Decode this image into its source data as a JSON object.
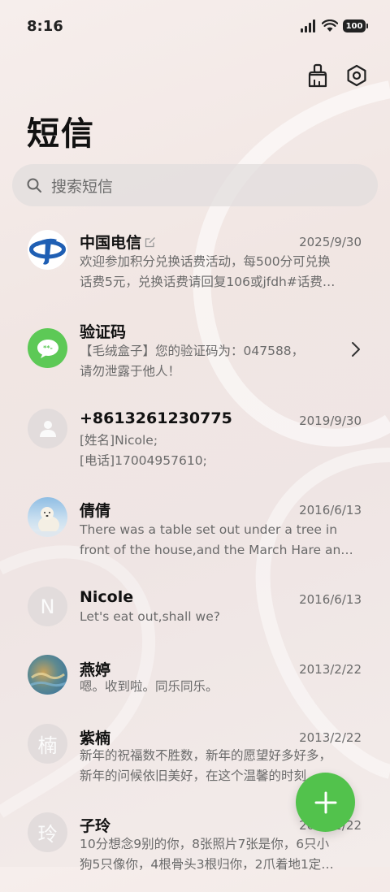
{
  "status": {
    "time": "8:16",
    "battery": "100"
  },
  "header": {
    "title": "短信"
  },
  "search": {
    "placeholder": "搜索短信"
  },
  "conversations": [
    {
      "name": "中国电信",
      "date": "2025/9/30",
      "avatar": "telecom-logo",
      "lines": [
        "欢迎参加积分兑换话费活动，每500分可兑换",
        "话费5元，兑换话费请回复106或jfdh#话费…"
      ]
    },
    {
      "name": "验证码",
      "date": "",
      "avatar": "message-bubble-icon",
      "lines": [
        "【毛绒盒子】您的验证码为：047588，",
        "请勿泄露于他人！"
      ]
    },
    {
      "name": "+8613261230775",
      "date": "2019/9/30",
      "avatar": "person-icon",
      "lines": [
        "[姓名]Nicole;",
        "[电话]17004957610;"
      ]
    },
    {
      "name": "倩倩",
      "date": "2016/6/13",
      "avatar": "polar-bear-photo",
      "lines": [
        "There was a table set out under a tree in",
        "front of the house,and the March Hare an…"
      ]
    },
    {
      "name": "Nicole",
      "date": "2016/6/13",
      "avatar_letter": "N",
      "lines": [
        "Let's eat out,shall we?"
      ]
    },
    {
      "name": "燕婷",
      "date": "2013/2/22",
      "avatar": "ocean-photo",
      "lines": [
        "嗯。收到啦。同乐同乐。"
      ]
    },
    {
      "name": "紫楠",
      "date": "2013/2/22",
      "avatar_letter": "楠",
      "lines": [
        "新年的祝福数不胜数，新年的愿望好多好多，",
        "新年的问候依旧美好，在这个温馨的时刻…"
      ]
    },
    {
      "name": "子玲",
      "date": "2013/2/22",
      "avatar_letter": "玲",
      "lines": [
        "10分想念9别的你，8张照片7张是你，6只小",
        "狗5只像你，4根骨头3根归你，2爪着地1定…"
      ]
    }
  ],
  "colors": {
    "accent": "#52c24c",
    "telecom_blue": "#1f5fb4"
  }
}
